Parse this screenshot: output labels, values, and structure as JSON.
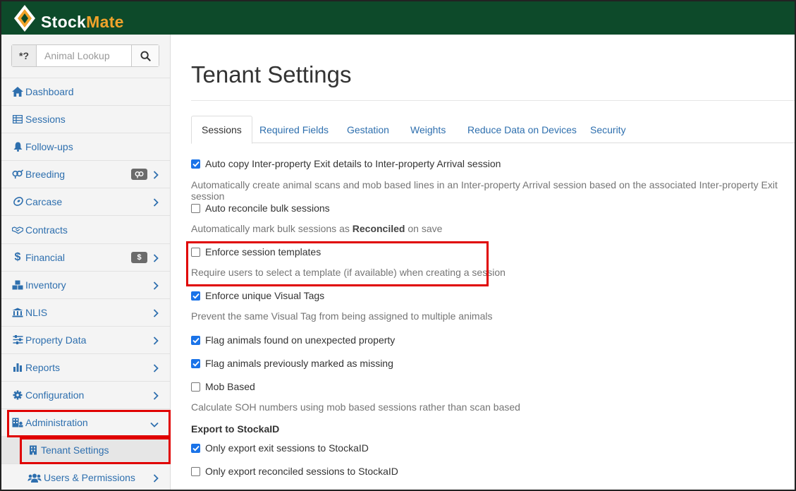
{
  "app": {
    "brand_part1": "Stock",
    "brand_part2": "Mate",
    "colors": {
      "header_bg": "#0d4a2a",
      "brand_accent": "#f0a32b",
      "link": "#2e6fae",
      "checkbox": "#1a73e8",
      "highlight": "#e00000"
    }
  },
  "search": {
    "prefix": "*?",
    "placeholder": "Animal Lookup",
    "button_icon": "search-icon"
  },
  "sidebar": {
    "items": [
      {
        "label": "Dashboard",
        "icon": "home-icon"
      },
      {
        "label": "Sessions",
        "icon": "table-icon"
      },
      {
        "label": "Follow-ups",
        "icon": "bell-icon"
      },
      {
        "label": "Breeding",
        "icon": "gender-icon",
        "badge": "gender-badge-icon"
      },
      {
        "label": "Carcase",
        "icon": "meat-icon"
      },
      {
        "label": "Contracts",
        "icon": "handshake-icon"
      },
      {
        "label": "Financial",
        "icon": "dollar-icon",
        "badge": "$"
      },
      {
        "label": "Inventory",
        "icon": "boxes-icon"
      },
      {
        "label": "NLIS",
        "icon": "building-columns-icon"
      },
      {
        "label": "Property Data",
        "icon": "sliders-icon"
      },
      {
        "label": "Reports",
        "icon": "bar-chart-icon"
      },
      {
        "label": "Configuration",
        "icon": "gear-icon"
      },
      {
        "label": "Administration",
        "icon": "building-icon"
      }
    ],
    "sub_items": [
      {
        "label": "Tenant Settings",
        "icon": "building-small-icon"
      },
      {
        "label": "Users & Permissions",
        "icon": "users-icon"
      }
    ]
  },
  "main": {
    "title": "Tenant Settings",
    "tabs": [
      "Sessions",
      "Required Fields",
      "Gestation",
      "Weights",
      "Reduce Data on Devices",
      "Security"
    ],
    "active_tab": "Sessions",
    "settings": [
      {
        "label": "Auto copy Inter-property Exit details to Inter-property Arrival session",
        "checked": true,
        "desc": "Automatically create animal scans and mob based lines in an Inter-property Arrival session based on the associated Inter-property Exit session"
      },
      {
        "label": "Auto reconcile bulk sessions",
        "checked": false,
        "desc_before": "Automatically mark bulk sessions as ",
        "desc_bold": "Reconciled",
        "desc_after": " on save"
      },
      {
        "label": "Enforce session templates",
        "checked": false,
        "desc": "Require users to select a template (if available) when creating a session"
      },
      {
        "label": "Enforce unique Visual Tags",
        "checked": true,
        "desc": "Prevent the same Visual Tag from being assigned to multiple animals"
      },
      {
        "label": "Flag animals found on unexpected property",
        "checked": true
      },
      {
        "label": "Flag animals previously marked as missing",
        "checked": true
      },
      {
        "label": "Mob Based",
        "checked": false,
        "desc": "Calculate SOH numbers using mob based sessions rather than scan based"
      }
    ],
    "export_section": {
      "heading": "Export to StockaID",
      "settings": [
        {
          "label": "Only export exit sessions to StockaID",
          "checked": true
        },
        {
          "label": "Only export reconciled sessions to StockaID",
          "checked": false
        }
      ]
    }
  }
}
